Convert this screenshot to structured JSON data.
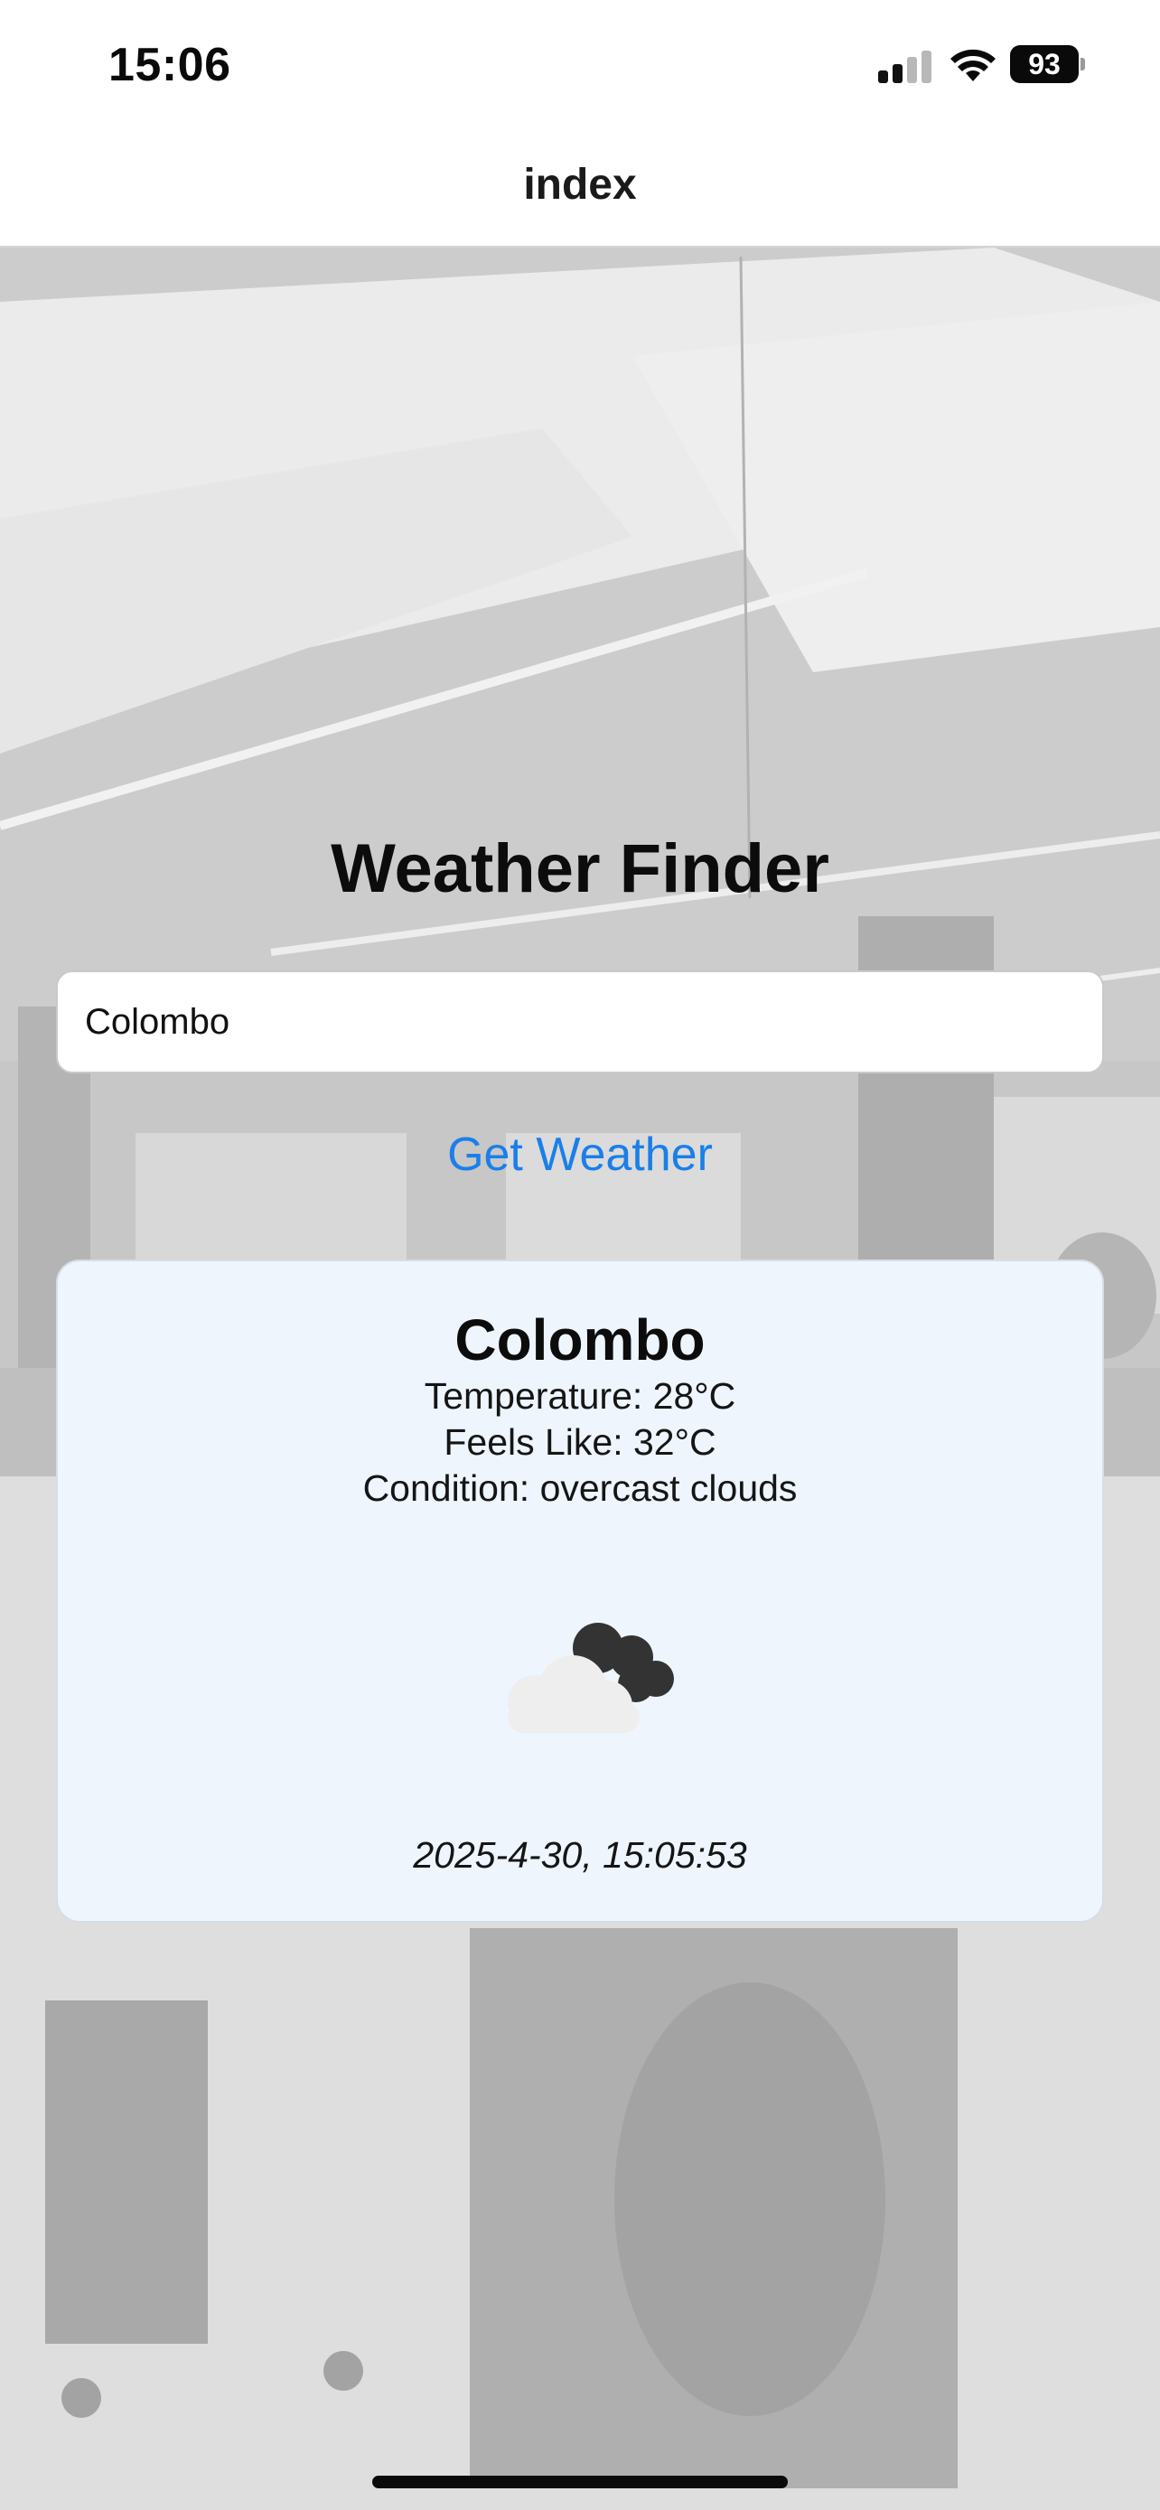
{
  "status_bar": {
    "time": "15:06",
    "battery_level": "93",
    "icons": [
      "cellular-signal-icon",
      "wifi-icon",
      "battery-icon"
    ]
  },
  "nav": {
    "title": "index"
  },
  "app": {
    "heading": "Weather Finder",
    "search": {
      "value": "Colombo",
      "placeholder": ""
    },
    "button_label": "Get Weather"
  },
  "weather": {
    "city": "Colombo",
    "temperature_text": "Temperature: 28°C",
    "feels_like_text": "Feels Like: 32°C",
    "condition_text": "Condition: overcast clouds",
    "icon": "overcast-clouds-icon",
    "timestamp": "2025-4-30, 15:05:53"
  },
  "colors": {
    "accent": "#1a7fe8",
    "card_background": "#eef5fd",
    "nav_background": "#ffffff"
  }
}
